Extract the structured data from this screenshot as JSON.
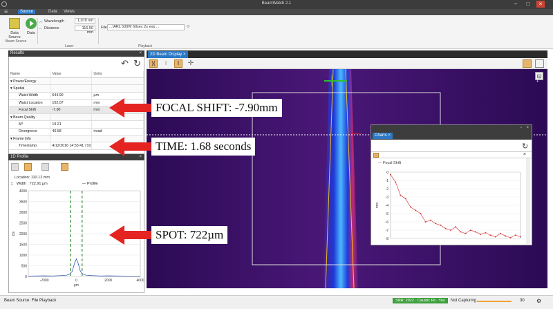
{
  "window": {
    "title": "BeamWatch 2.1"
  },
  "menu": {
    "items": [
      "Source",
      "Data",
      "Views"
    ]
  },
  "ribbon": {
    "data_source_label": "Data Source",
    "data_label": "Data",
    "wavelength_label": "Wavelength",
    "wavelength_value": "1,070 nm",
    "distance_label": "Distance",
    "distance_value": "116.50 mm",
    "file_label": "File",
    "file_value": "...\\ARL 500W 60sec 2s exp ...",
    "groups": {
      "beam_source": "Beam Source",
      "laser": "Laser",
      "playback": "Playback"
    }
  },
  "results": {
    "title": "Results",
    "columns": [
      "Name",
      "Value",
      "Units"
    ],
    "rows": [
      {
        "name": "Power/Energy",
        "value": "",
        "units": "",
        "type": "group"
      },
      {
        "name": "Spatial",
        "value": "",
        "units": "",
        "type": "group"
      },
      {
        "name": "Waist Width",
        "value": "644.90",
        "units": "µm",
        "type": "item"
      },
      {
        "name": "Waist Location",
        "value": "102.07",
        "units": "mm",
        "type": "item"
      },
      {
        "name": "Focal Shift",
        "value": "-7.90",
        "units": "mm",
        "type": "item"
      },
      {
        "name": "Beam Quality",
        "value": "",
        "units": "",
        "type": "group"
      },
      {
        "name": "M²",
        "value": "19.21",
        "units": "",
        "type": "item"
      },
      {
        "name": "Divergence",
        "value": "40.58",
        "units": "mrad",
        "type": "item"
      },
      {
        "name": "Frame Info",
        "value": "",
        "units": "",
        "type": "group"
      },
      {
        "name": "Timestamp",
        "value": "4/12/2016 14:53:41.710",
        "units": "",
        "type": "item"
      }
    ]
  },
  "profile": {
    "title": "1D Profile",
    "location": "Location: 110.12 mm",
    "width": "Width : 722.91 µm",
    "legend": "Profile",
    "ylabel": "cts",
    "xlabel": "µm"
  },
  "beam_display": {
    "tab": "2D Beam Display"
  },
  "charts_window": {
    "title": "Charts",
    "tab": "Charts",
    "legend": "Focal Shift",
    "ylabel": "mm"
  },
  "callouts": {
    "focal_shift": "FOCAL SHIFT: -7.90mm",
    "time": "TIME: 1.68 seconds",
    "spot": "SPOT: 722µm"
  },
  "status": {
    "beam_source": "Beam Source: File Playback",
    "badge1": "SNR: 2022 · Caustic Fit · Yes",
    "capturing": "Not Capturing",
    "fps": "30"
  },
  "colors": {
    "accent": "#2a78c5",
    "callout_arrow": "#e52421",
    "beam_bg": "#3a0f63",
    "status_green": "#3f9f3f"
  },
  "chart_data": [
    {
      "type": "line",
      "title": "",
      "xlabel": "µm",
      "ylabel": "cts",
      "series": [
        {
          "name": "Profile",
          "x": [
            -3000,
            -2000,
            -1500,
            -1000,
            -600,
            -400,
            -250,
            -120,
            0,
            120,
            250,
            400,
            600,
            1000,
            1500,
            2000,
            3000,
            4000
          ],
          "values": [
            20,
            30,
            25,
            40,
            60,
            120,
            250,
            600,
            820,
            600,
            250,
            120,
            60,
            40,
            25,
            30,
            20,
            15
          ]
        }
      ],
      "xlim": [
        -3000,
        4000
      ],
      "ylim": [
        0,
        4000
      ],
      "xticks": [
        -2000,
        0,
        2000,
        4000
      ],
      "yticks": [
        0,
        500,
        1000,
        1500,
        2000,
        2500,
        3000,
        3500,
        4000
      ]
    },
    {
      "type": "line",
      "title": "Focal Shift",
      "ylabel": "mm",
      "series": [
        {
          "name": "Focal Shift",
          "values": [
            -0.3,
            -1.2,
            -2.8,
            -3.2,
            -4.2,
            -4.6,
            -5.0,
            -6.0,
            -5.8,
            -6.2,
            -6.4,
            -6.8,
            -7.0,
            -6.6,
            -7.2,
            -7.4,
            -7.0,
            -7.2,
            -7.5,
            -7.3,
            -7.6,
            -7.8,
            -7.4,
            -7.7,
            -7.9,
            -7.6,
            -7.8
          ]
        }
      ],
      "ylim": [
        -8,
        0
      ],
      "yticks": [
        0,
        -1,
        -2,
        -3,
        -4,
        -5,
        -6,
        -7,
        -8
      ]
    }
  ]
}
